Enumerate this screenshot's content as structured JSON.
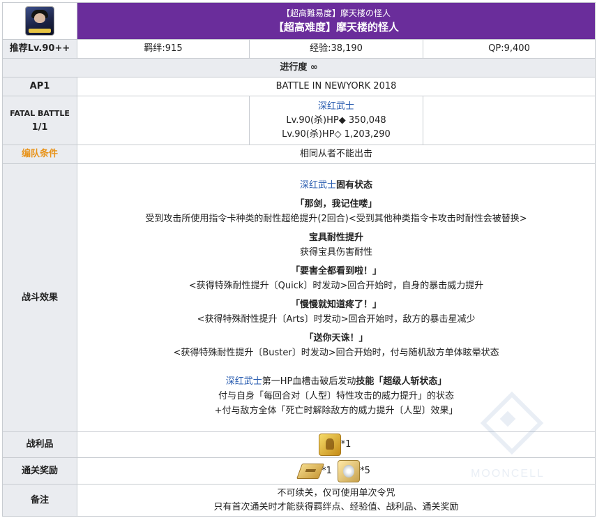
{
  "header": {
    "title_jp": "【超高難易度】摩天楼の怪人",
    "title_cn": "【超高难度】摩天楼的怪人",
    "avatar_icon": "servant-portrait-icon",
    "background_color": "#6a2d9b"
  },
  "stats": {
    "recommended_label": "推荐Lv.90++",
    "bond": "羁绊:915",
    "exp": "经验:38,190",
    "qp": "QP:9,400"
  },
  "progress_label": "进行度 ∞",
  "ap": {
    "label": "AP1",
    "battle_name": "BATTLE IN NEWYORK 2018"
  },
  "fatal_battle": {
    "label_line1": "FATAL BATTLE",
    "label_line2": "1/1",
    "enemy_name": "深红武士",
    "hp_line1": "Lv.90(杀)HP◆ 350,048",
    "hp_line2": "Lv.90(杀)HP◇ 1,203,290"
  },
  "formation": {
    "label": "编队条件",
    "value": "相同从者不能出击",
    "label_color": "#e8941c"
  },
  "battle_effects": {
    "label": "战斗效果",
    "intro_name": "深红武士",
    "intro_suffix": "固有状态",
    "effects": [
      {
        "title": "「那剑，我记住喽」",
        "desc": "受到攻击所使用指令卡种类的耐性超绝提升(2回合)<受到其他种类指令卡攻击时耐性会被替换>"
      },
      {
        "title": "宝具耐性提升",
        "desc": "获得宝具伤害耐性"
      },
      {
        "title": "「要害全都看到啦！」",
        "desc": "<获得特殊耐性提升〔Quick〕时发动>回合开始时，自身的暴击威力提升"
      },
      {
        "title": "「慢慢就知道疼了！」",
        "desc": "<获得特殊耐性提升〔Arts〕时发动>回合开始时，敌方的暴击星减少"
      },
      {
        "title": "「送你天诛！」",
        "desc": "<获得特殊耐性提升〔Buster〕时发动>回合开始时，付与随机敌方单体眩晕状态"
      }
    ],
    "trigger_name": "深红武士",
    "trigger_mid": "第一HP血槽击破后发动",
    "trigger_bold": "技能「超级人斩状态」",
    "trigger_line2": "付与自身「每回合对〔人型〕特性攻击的威力提升」的状态",
    "trigger_line3": "+付与敌方全体「死亡时解除敌方的威力提升〔人型〕效果」"
  },
  "drops": {
    "label": "战利品",
    "item_icon": "gold-statue-icon",
    "qty": "*1"
  },
  "clear_reward": {
    "label": "通关奖励",
    "item1_icon": "gold-ticket-icon",
    "item1_qty": "*1",
    "item2_icon": "saint-quartz-fragment-icon",
    "item2_qty": "*5"
  },
  "notes": {
    "label": "备注",
    "line1": "不可续关，仅可使用单次令咒",
    "line2": "只有首次通关时才能获得羁绊点、经验值、战利品、通关奖励"
  },
  "watermark": {
    "text": "MOONCELL"
  }
}
